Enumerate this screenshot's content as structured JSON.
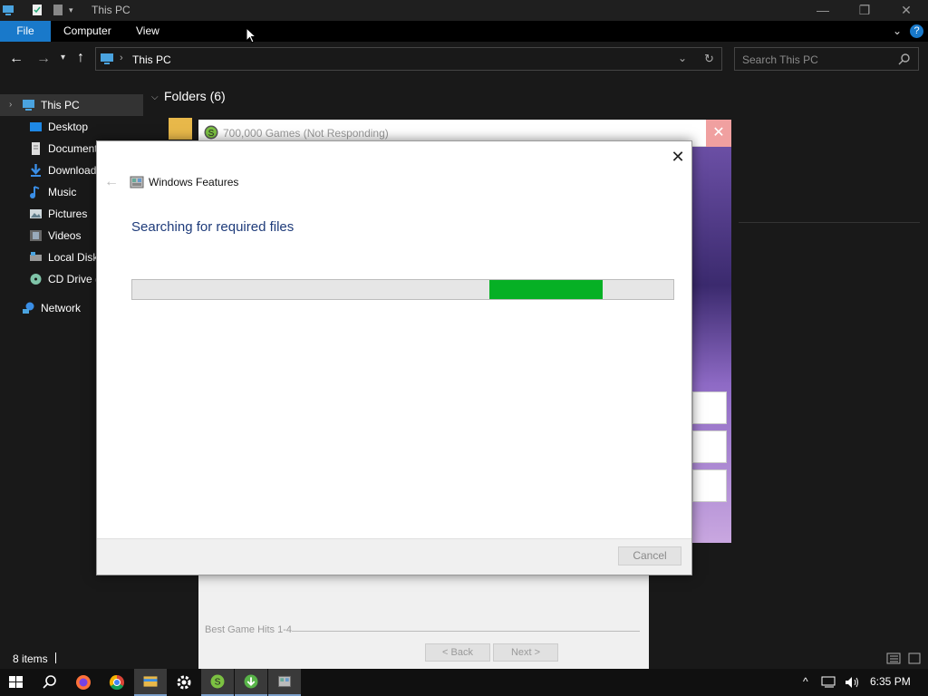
{
  "explorer": {
    "title": "This PC",
    "ribbon_tabs": [
      "File",
      "Computer",
      "View"
    ],
    "address": "This PC",
    "search_placeholder": "Search This PC",
    "nav_items": [
      {
        "label": "This PC",
        "icon": "computer-icon"
      },
      {
        "label": "Desktop",
        "icon": "desktop-icon"
      },
      {
        "label": "Documents",
        "icon": "documents-icon"
      },
      {
        "label": "Downloads",
        "icon": "downloads-icon"
      },
      {
        "label": "Music",
        "icon": "music-icon"
      },
      {
        "label": "Pictures",
        "icon": "pictures-icon"
      },
      {
        "label": "Videos",
        "icon": "videos-icon"
      },
      {
        "label": "Local Disk",
        "icon": "disk-icon"
      },
      {
        "label": "CD Drive (",
        "icon": "cd-drive-icon"
      },
      {
        "label": "Network",
        "icon": "network-icon"
      }
    ],
    "folders_header": "Folders (6)",
    "status": "8 items"
  },
  "installer": {
    "title": "700,000 Games (Not Responding)",
    "footer_label": "Best Game Hits 1-4",
    "back_label": "< Back",
    "next_label": "Next >"
  },
  "dialog": {
    "title": "Windows Features",
    "heading": "Searching for required files",
    "progress_start": 0.66,
    "progress_end": 0.87,
    "cancel_label": "Cancel"
  },
  "taskbar": {
    "clock": "6:35 PM"
  },
  "colors": {
    "accent": "#1979ca",
    "progress": "#06b025",
    "heading": "#1e3b7a"
  }
}
